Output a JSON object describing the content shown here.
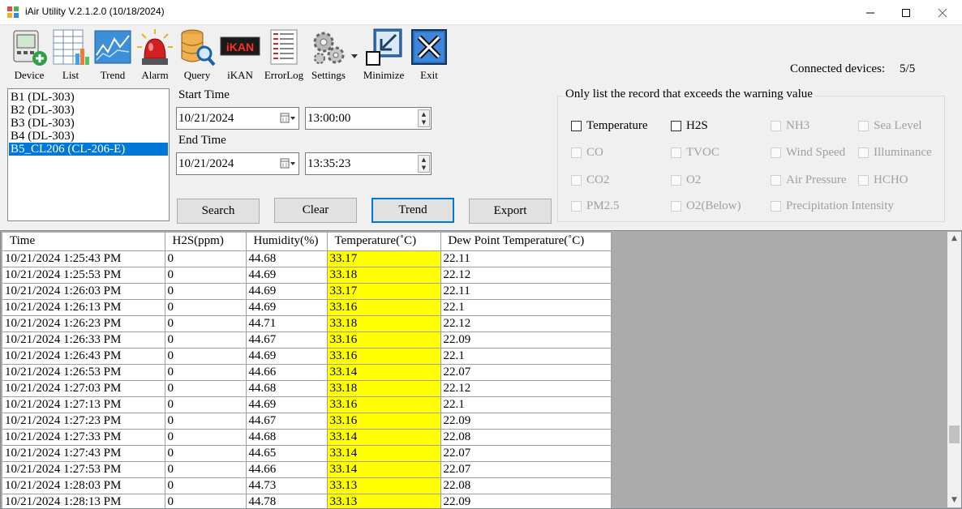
{
  "window": {
    "title": "iAir Utility V.2.1.2.0 (10/18/2024)",
    "icon": "app-puzzle-icon",
    "controls": [
      "minimize-icon",
      "maximize-icon",
      "close-icon"
    ]
  },
  "toolbar": {
    "device": "Device",
    "list": "List",
    "trend": "Trend",
    "alarm": "Alarm",
    "query": "Query",
    "ikan": "iKAN",
    "ikan_display": "iKAN",
    "errorlog": "ErrorLog",
    "settings": "Settings",
    "minimize": "Minimize",
    "exit": "Exit"
  },
  "status": {
    "connected_label": "Connected devices:",
    "connected_value": "5/5"
  },
  "devices": [
    "B1 (DL-303)",
    "B2 (DL-303)",
    "B3 (DL-303)",
    "B4 (DL-303)",
    "B5_CL206 (CL-206-E)"
  ],
  "selected_device_index": 4,
  "query": {
    "start_label": "Start Time",
    "start_date": "10/21/2024",
    "start_time": "13:00:00",
    "end_label": "End Time",
    "end_date": "10/21/2024",
    "end_time": "13:35:23"
  },
  "buttons": {
    "search": "Search",
    "clear": "Clear",
    "trend": "Trend",
    "export": "Export"
  },
  "warning_filter": {
    "legend": "Only list the record that exceeds the warning value",
    "options": {
      "temperature": "Temperature",
      "h2s": "H2S",
      "nh3": "NH3",
      "sea_level": "Sea Level",
      "co": "CO",
      "tvoc": "TVOC",
      "wind_speed": "Wind Speed",
      "illuminance": "Illuminance",
      "co2": "CO2",
      "o2": "O2",
      "air_pressure": "Air Pressure",
      "hcho": "HCHO",
      "pm25": "PM2.5",
      "o2_below": "O2(Below)",
      "precipitation": "Precipitation Intensity"
    },
    "enabled": [
      "temperature",
      "h2s"
    ]
  },
  "table": {
    "columns": [
      "Time",
      "H2S(ppm)",
      "Humidity(%)",
      "Temperature(˚C)",
      "Dew Point Temperature(˚C)"
    ],
    "highlight_color": "#ffff00",
    "rows": [
      [
        "10/21/2024 1:25:43 PM",
        "0",
        "44.68",
        "33.17",
        "22.11"
      ],
      [
        "10/21/2024 1:25:53 PM",
        "0",
        "44.69",
        "33.18",
        "22.12"
      ],
      [
        "10/21/2024 1:26:03 PM",
        "0",
        "44.69",
        "33.17",
        "22.11"
      ],
      [
        "10/21/2024 1:26:13 PM",
        "0",
        "44.69",
        "33.16",
        "22.1"
      ],
      [
        "10/21/2024 1:26:23 PM",
        "0",
        "44.71",
        "33.18",
        "22.12"
      ],
      [
        "10/21/2024 1:26:33 PM",
        "0",
        "44.67",
        "33.16",
        "22.09"
      ],
      [
        "10/21/2024 1:26:43 PM",
        "0",
        "44.69",
        "33.16",
        "22.1"
      ],
      [
        "10/21/2024 1:26:53 PM",
        "0",
        "44.66",
        "33.14",
        "22.07"
      ],
      [
        "10/21/2024 1:27:03 PM",
        "0",
        "44.68",
        "33.18",
        "22.12"
      ],
      [
        "10/21/2024 1:27:13 PM",
        "0",
        "44.69",
        "33.16",
        "22.1"
      ],
      [
        "10/21/2024 1:27:23 PM",
        "0",
        "44.67",
        "33.16",
        "22.09"
      ],
      [
        "10/21/2024 1:27:33 PM",
        "0",
        "44.68",
        "33.14",
        "22.08"
      ],
      [
        "10/21/2024 1:27:43 PM",
        "0",
        "44.65",
        "33.14",
        "22.07"
      ],
      [
        "10/21/2024 1:27:53 PM",
        "0",
        "44.66",
        "33.14",
        "22.07"
      ],
      [
        "10/21/2024 1:28:03 PM",
        "0",
        "44.73",
        "33.13",
        "22.08"
      ],
      [
        "10/21/2024 1:28:13 PM",
        "0",
        "44.78",
        "33.13",
        "22.09"
      ]
    ]
  }
}
